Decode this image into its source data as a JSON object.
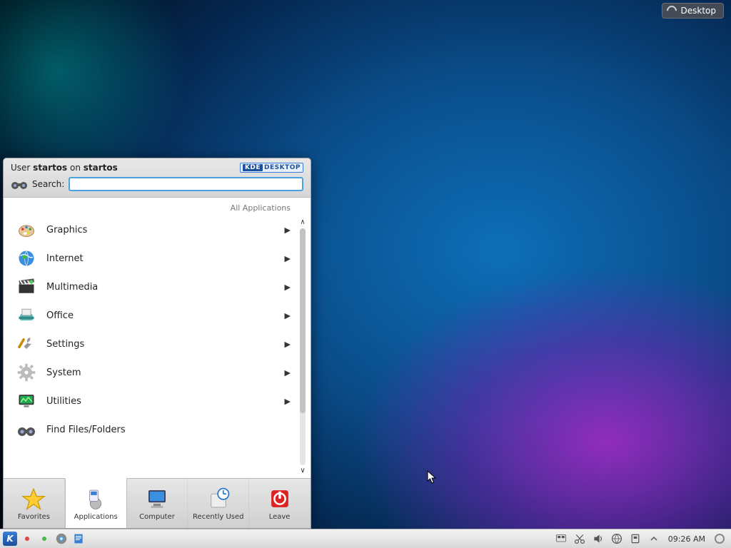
{
  "activity": {
    "label": "Desktop"
  },
  "kickoff": {
    "user_prefix": "User ",
    "username": "startos",
    "on_word": " on ",
    "hostname": "startos",
    "badge_left": "KDE",
    "badge_right": "DESKTOP",
    "search_label": "Search:",
    "search_placeholder": "",
    "section_label": "All Applications",
    "items": [
      {
        "label": "Graphics",
        "icon": "palette-icon",
        "has_sub": true
      },
      {
        "label": "Internet",
        "icon": "globe-icon",
        "has_sub": true
      },
      {
        "label": "Multimedia",
        "icon": "clapper-icon",
        "has_sub": true
      },
      {
        "label": "Office",
        "icon": "typewriter-icon",
        "has_sub": true
      },
      {
        "label": "Settings",
        "icon": "wrench-icon",
        "has_sub": true
      },
      {
        "label": "System",
        "icon": "gear-icon",
        "has_sub": true
      },
      {
        "label": "Utilities",
        "icon": "monitor-icon",
        "has_sub": true
      },
      {
        "label": "Find Files/Folders",
        "icon": "binoculars-icon",
        "has_sub": false
      }
    ],
    "tabs": [
      {
        "label": "Favorites",
        "icon": "star-icon"
      },
      {
        "label": "Applications",
        "icon": "apps-icon"
      },
      {
        "label": "Computer",
        "icon": "computer-icon"
      },
      {
        "label": "Recently Used",
        "icon": "clock-icon"
      },
      {
        "label": "Leave",
        "icon": "power-icon"
      }
    ],
    "active_tab_index": 1
  },
  "taskbar": {
    "clock": "09:26 AM",
    "launchers": [
      {
        "name": "kmenu-button",
        "icon": "klogo-icon"
      },
      {
        "name": "pager-red",
        "icon": "dot-red-icon"
      },
      {
        "name": "pager-green",
        "icon": "dot-green-icon"
      },
      {
        "name": "browser-launcher",
        "icon": "chromium-icon"
      },
      {
        "name": "notes-launcher",
        "icon": "notes-icon"
      }
    ],
    "tray": [
      {
        "name": "show-desktop-icon",
        "icon": "show-desktop-icon"
      },
      {
        "name": "klipper-icon",
        "icon": "scissors-icon"
      },
      {
        "name": "volume-icon",
        "icon": "speaker-icon"
      },
      {
        "name": "network-icon",
        "icon": "network-icon"
      },
      {
        "name": "device-icon",
        "icon": "device-icon"
      },
      {
        "name": "expand-tray-icon",
        "icon": "chevron-up-icon"
      }
    ]
  }
}
